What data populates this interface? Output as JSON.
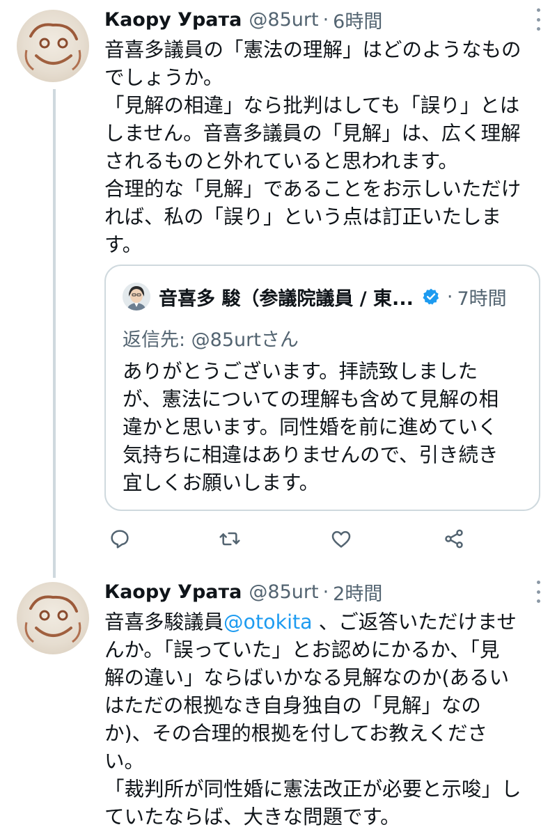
{
  "tweet1": {
    "name": "Каору Урата",
    "handle": "@85urt",
    "separator": "·",
    "time": "6時間",
    "lines": [
      "音喜多議員の「憲法の理解」はどのようなもの",
      "でしょうか。",
      "「見解の相違」なら批判はしても「誤り」とは",
      "しません。音喜多議員の「見解」は、広く理解",
      "されるものと外れていると思われます。",
      "合理的な「見解」であることをお示しいただけ",
      "れば、私の「誤り」という点は訂正いたしま",
      "す。"
    ]
  },
  "quote": {
    "name": "音喜多 駿（参議院議員 / 東...",
    "separator": "·",
    "time": "7時間",
    "reply_to": "返信先: @85urtさん",
    "lines": [
      "ありがとうございます。拝読致しました",
      "が、憲法についての理解も含めて見解の相",
      "違かと思います。同性婚を前に進めていく",
      "気持ちに相違はありませんので、引き続き",
      "宜しくお願いします。"
    ]
  },
  "actions": {
    "icons": [
      "reply-icon",
      "retweet-icon",
      "like-icon",
      "share-icon"
    ]
  },
  "tweet2": {
    "name": "Каору Урата",
    "handle": "@85urt",
    "separator": "·",
    "time": "2時間",
    "line1_prefix": "音喜多駿議員",
    "line1_mention": "@otokita",
    "line1_suffix": " 、ご返答いただけませ",
    "lines": [
      "んか。「誤っていた」とお認めにかるか、「見",
      "解の違い」ならばいかなる見解なのか(あるい",
      "はただの根拠なき自身独自の「見解」なの",
      "か)、その合理的根拠を付してお教えくださ",
      "い。",
      "「裁判所が同性婚に憲法改正が必要と示唆」し",
      "ていたならば、大きな問題です。"
    ]
  },
  "colors": {
    "link": "#1d9bf0",
    "secondary_text": "#536471",
    "border": "#cfd9de",
    "verified": "#1d9bf0"
  }
}
